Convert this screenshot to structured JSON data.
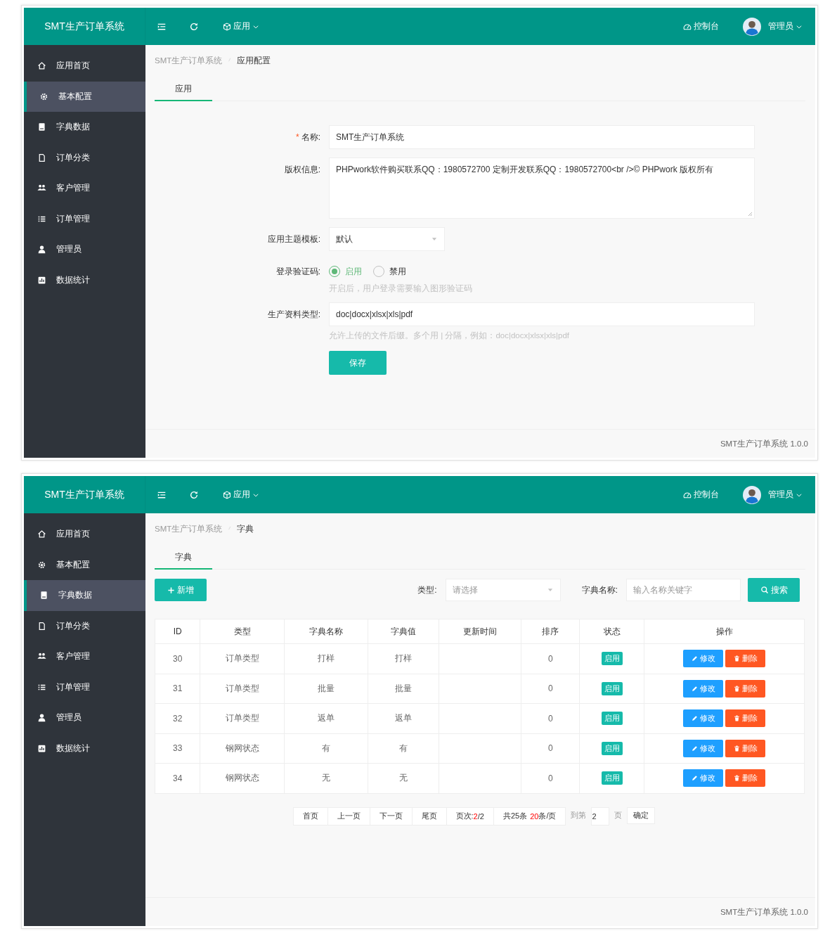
{
  "screens": [
    {
      "kind": "config",
      "header": {
        "logo": "SMT生产订单系统",
        "app_menu": "应用",
        "console": "控制台",
        "user": "管理员"
      },
      "sidebar": [
        {
          "label": "应用首页",
          "selected": false
        },
        {
          "label": "基本配置",
          "selected": true
        },
        {
          "label": "字典数据",
          "selected": false
        },
        {
          "label": "订单分类",
          "selected": false
        },
        {
          "label": "客户管理",
          "selected": false
        },
        {
          "label": "订单管理",
          "selected": false
        },
        {
          "label": "管理员",
          "selected": false
        },
        {
          "label": "数据统计",
          "selected": false
        }
      ],
      "breadcrumb": [
        "SMT生产订单系统",
        "应用配置"
      ],
      "tabs": [
        {
          "label": "应用",
          "selected": true
        }
      ],
      "form": {
        "fields": [
          {
            "kind": "text",
            "label": "名称:",
            "required_mark": "*",
            "value": "SMT生产订单系统"
          },
          {
            "kind": "textarea",
            "label": "版权信息:",
            "value": "PHPwork软件购买联系QQ：1980572700 定制开发联系QQ：1980572700<br />© PHPwork 版权所有"
          },
          {
            "kind": "select",
            "label": "应用主题模板:",
            "value": "默认"
          },
          {
            "kind": "radio",
            "label": "登录验证码:",
            "options": [
              {
                "label": "启用",
                "selected": true
              },
              {
                "label": "禁用",
                "selected": false
              }
            ],
            "help": "开启后，用户登录需要输入图形验证码"
          },
          {
            "kind": "text",
            "label": "生产资料类型:",
            "value": "doc|docx|xlsx|xls|pdf",
            "help": "允许上传的文件后缀。多个用 | 分隔，例如：doc|docx|xlsx|xls|pdf"
          }
        ],
        "submit": "保存"
      },
      "footer": "SMT生产订单系统 1.0.0"
    },
    {
      "kind": "dictionary",
      "header": {
        "logo": "SMT生产订单系统",
        "app_menu": "应用",
        "console": "控制台",
        "user": "管理员"
      },
      "sidebar": [
        {
          "label": "应用首页",
          "selected": false
        },
        {
          "label": "基本配置",
          "selected": false
        },
        {
          "label": "字典数据",
          "selected": true
        },
        {
          "label": "订单分类",
          "selected": false
        },
        {
          "label": "客户管理",
          "selected": false
        },
        {
          "label": "订单管理",
          "selected": false
        },
        {
          "label": "管理员",
          "selected": false
        },
        {
          "label": "数据统计",
          "selected": false
        }
      ],
      "breadcrumb": [
        "SMT生产订单系统",
        "字典"
      ],
      "tabs": [
        {
          "label": "字典",
          "selected": true
        }
      ],
      "toolbar": {
        "add": "新增",
        "type_label": "类型:",
        "type_placeholder": "请选择",
        "name_label": "字典名称:",
        "name_placeholder": "输入名称关键字",
        "search": "搜索"
      },
      "table": {
        "columns": [
          "ID",
          "类型",
          "字典名称",
          "字典值",
          "更新时间",
          "排序",
          "状态",
          "操作"
        ],
        "rows": [
          {
            "id": "30",
            "type": "订单类型",
            "name": "打样",
            "value": "打样",
            "sort": "0",
            "status": "启用",
            "actions": [
              "修改",
              "删除"
            ]
          },
          {
            "id": "31",
            "type": "订单类型",
            "name": "批量",
            "value": "批量",
            "sort": "0",
            "status": "启用",
            "actions": [
              "修改",
              "删除"
            ]
          },
          {
            "id": "32",
            "type": "订单类型",
            "name": "返单",
            "value": "返单",
            "sort": "0",
            "status": "启用",
            "actions": [
              "修改",
              "删除"
            ]
          },
          {
            "id": "33",
            "type": "钢网状态",
            "name": "有",
            "value": "有",
            "sort": "0",
            "status": "启用",
            "actions": [
              "修改",
              "删除"
            ]
          },
          {
            "id": "34",
            "type": "钢网状态",
            "name": "无",
            "value": "无",
            "sort": "0",
            "status": "启用",
            "actions": [
              "修改",
              "删除"
            ]
          }
        ]
      },
      "pagination": {
        "first": "首页",
        "prev": "上一页",
        "next": "下一页",
        "last": "尾页",
        "page_label": "页次:",
        "page_current": "2",
        "page_total": "/2",
        "total": "共25条",
        "per_page": "20",
        "per_page_unit": "条/页",
        "goto_label": "到第",
        "goto_value": "2",
        "page_unit": "页",
        "confirm": "确定"
      },
      "footer": "SMT生产订单系统 1.0.0"
    }
  ]
}
